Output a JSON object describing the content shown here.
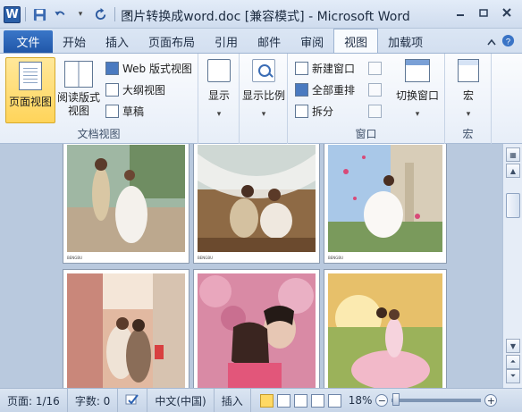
{
  "window": {
    "title": "图片转换成word.doc [兼容模式] - Microsoft Word",
    "app_letter": "W"
  },
  "tabs": [
    {
      "label": "文件"
    },
    {
      "label": "开始"
    },
    {
      "label": "插入"
    },
    {
      "label": "页面布局"
    },
    {
      "label": "引用"
    },
    {
      "label": "邮件"
    },
    {
      "label": "审阅"
    },
    {
      "label": "视图"
    },
    {
      "label": "加载项"
    }
  ],
  "active_tab": "视图",
  "ribbon": {
    "doc_views": {
      "group_label": "文档视图",
      "page_view": "页面视图",
      "reading_view_line1": "阅读版式",
      "reading_view_line2": "视图",
      "web_view": "Web 版式视图",
      "outline_view": "大纲视图",
      "draft_view": "草稿"
    },
    "show": {
      "label": "显示"
    },
    "zoom": {
      "label": "显示比例"
    },
    "window": {
      "group_label": "窗口",
      "new_window": "新建窗口",
      "arrange_all": "全部重排",
      "split": "拆分",
      "switch_windows": "切换窗口"
    },
    "macros": {
      "group_label": "宏",
      "label": "宏"
    }
  },
  "document": {
    "photo_captions": [
      "BENGBU",
      "BENGBU",
      "BENGBU"
    ]
  },
  "status": {
    "page": "页面: 1/16",
    "words": "字数: 0",
    "language": "中文(中国)",
    "insert_mode": "插入",
    "zoom": "18%",
    "zoom_percent": 18
  },
  "colors": {
    "file_tab": "#2157a8",
    "active_view_button": "#ffd45a",
    "document_bg": "#b9c9de"
  }
}
